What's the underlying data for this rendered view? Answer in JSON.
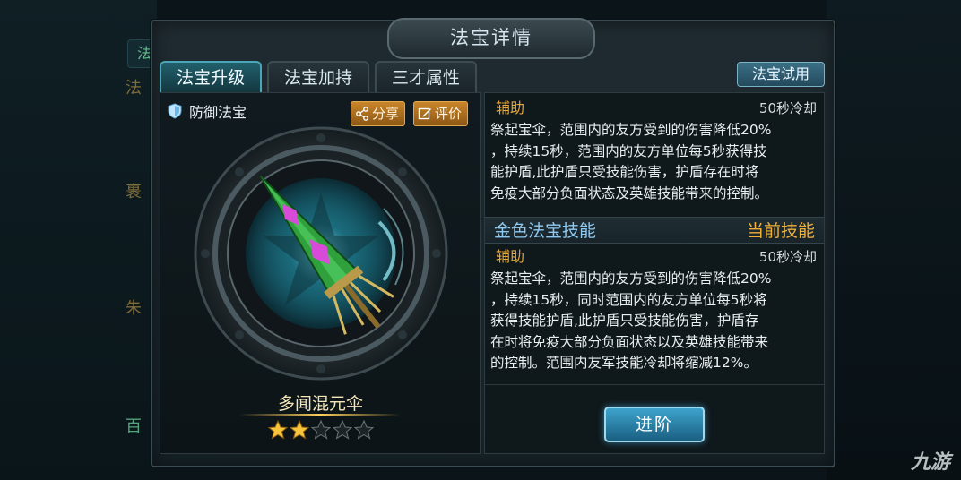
{
  "window": {
    "title": "法宝详情"
  },
  "tabs": [
    {
      "label": "法宝升级",
      "active": true
    },
    {
      "label": "法宝加持",
      "active": false
    },
    {
      "label": "三才属性",
      "active": false
    }
  ],
  "trial_button": "法宝试用",
  "treasure": {
    "type_label": "防御法宝",
    "share_label": "分享",
    "review_label": "评价",
    "name": "多闻混元伞",
    "stars_filled": 2,
    "stars_total": 5
  },
  "skills": {
    "base": {
      "category": "辅助",
      "cooldown": "50秒冷却",
      "description": "祭起宝伞，范围内的友方受到的伤害降低20%\n，持续15秒，范围内的友方单位每5秒获得技\n能护盾,此护盾只受技能伤害，护盾存在时将\n免疫大部分负面状态及英雄技能带来的控制。"
    },
    "gold_header": {
      "title": "金色法宝技能",
      "current_label": "当前技能"
    },
    "gold": {
      "category": "辅助",
      "cooldown": "50秒冷却",
      "description": "祭起宝伞，范围内的友方受到的伤害降低20%\n，持续15秒，同时范围内的友方单位每5秒将\n获得技能护盾,此护盾只受技能伤害，护盾存\n在时将免疫大部分负面状态以及英雄技能带来\n的控制。范围内友军技能冷却将缩减12%。"
    }
  },
  "advance_button": "进阶",
  "watermark": "九游",
  "background_fragments": {
    "tab_char": "法",
    "side_chars": [
      "法",
      "裹",
      "朱",
      "百"
    ]
  },
  "colors": {
    "accent_gold": "#f0b13a",
    "accent_blue": "#8ec9f2",
    "active_tab": "#21606c"
  }
}
